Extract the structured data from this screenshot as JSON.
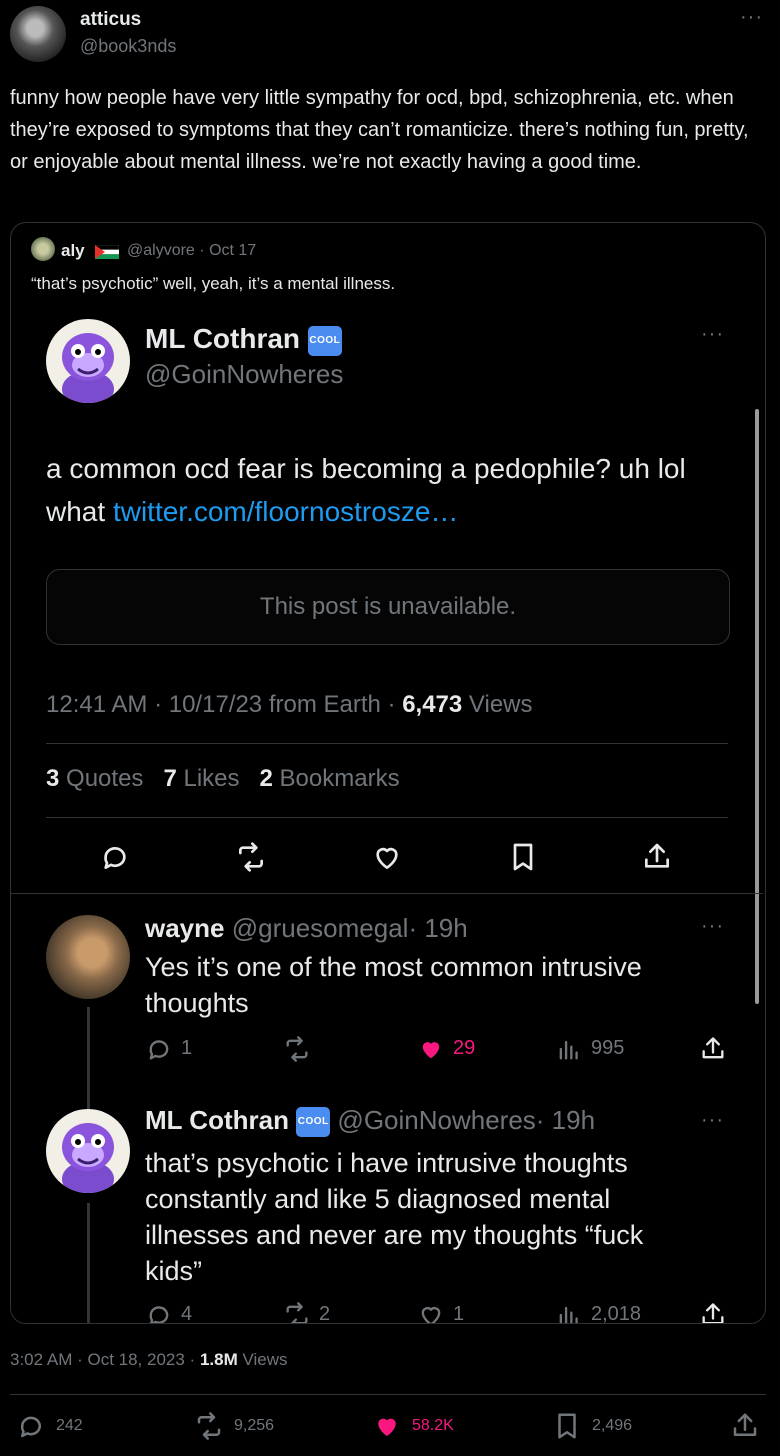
{
  "author": {
    "name": "atticus",
    "handle": "@book3nds"
  },
  "menu_dots": "···",
  "tweet_text": "funny how people have very little sympathy for ocd, bpd, schizophrenia, etc. when they’re exposed to symptoms that they can’t romanticize. there’s nothing fun, pretty, or enjoyable about mental illness. we’re not exactly having a good time.",
  "quote": {
    "name": "aly",
    "handle": "@alyvore",
    "separator": "·",
    "date": "Oct 17",
    "text": "“that’s psychotic” well, yeah, it’s a mental illness.",
    "screenshot": {
      "post": {
        "name": "ML Cothran",
        "badge": "COOL",
        "handle": "@GoinNowheres",
        "text": "a common ocd fear is becoming a pedophile? uh lol what",
        "link": "twitter.com/floornostrosze…",
        "unavailable": "This post is unavailable.",
        "timestamp": "12:41 AM · 10/17/23 from Earth ·",
        "views_count": "6,473",
        "views_label": "Views",
        "quotes_count": "3",
        "quotes_label": "Quotes",
        "likes_count": "7",
        "likes_label": "Likes",
        "bookmarks_count": "2",
        "bookmarks_label": "Bookmarks"
      },
      "replies": [
        {
          "name": "wayne",
          "handle": "@gruesomegal",
          "time": "· 19h",
          "text": "Yes it’s one of the most common intrusive thoughts",
          "replies": "1",
          "retweets": "",
          "likes": "29",
          "views": "995"
        },
        {
          "name": "ML Cothran",
          "badge": "COOL",
          "handle": "@GoinNowheres",
          "time": "· 19h",
          "text": "that’s psychotic i have intrusive thoughts constantly and like 5 diagnosed mental illnesses and never are my thoughts “fuck kids”",
          "replies": "4",
          "retweets": "2",
          "likes": "1",
          "views": "2,018"
        }
      ]
    }
  },
  "footer": {
    "time": "3:02 AM · Oct 18, 2023 ·",
    "views_count": "1.8M",
    "views_label": "Views",
    "replies": "242",
    "retweets": "9,256",
    "likes": "58.2K",
    "bookmarks": "2,496"
  },
  "colors": {
    "like_pink": "#f91880",
    "link_blue": "#1d9bf0",
    "muted": "#71767b",
    "border": "#2f3336"
  }
}
